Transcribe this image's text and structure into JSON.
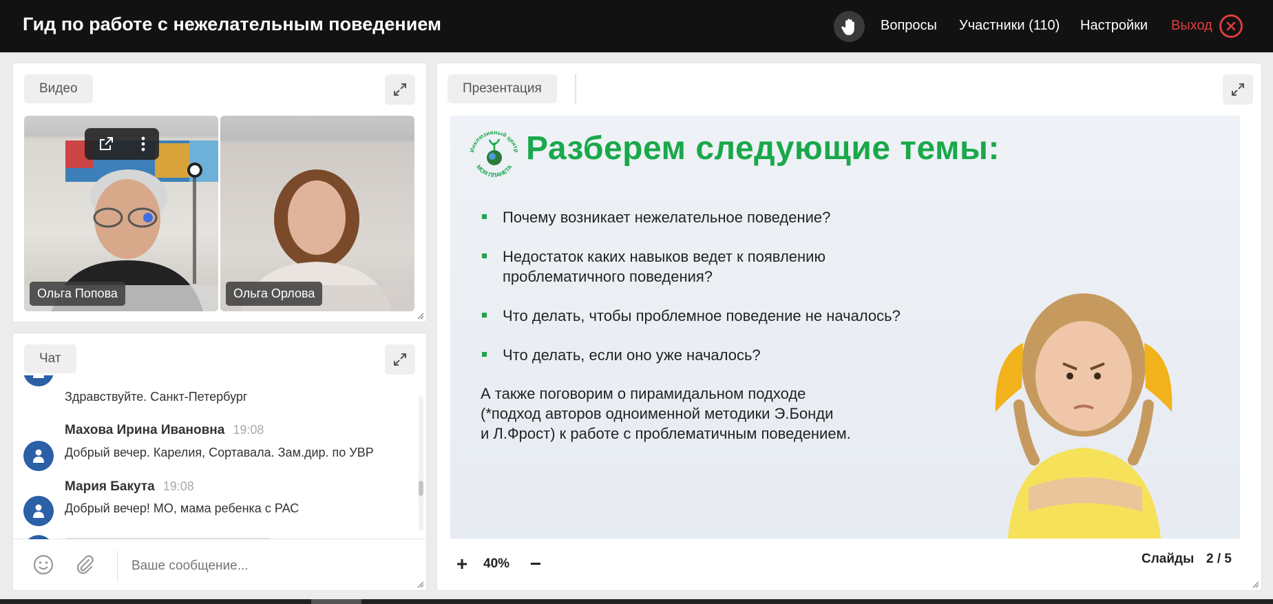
{
  "header": {
    "title": "Гид по работе с нежелательным поведением",
    "nav": {
      "questions": "Вопросы",
      "participants": "Участники (110)",
      "settings": "Настройки",
      "exit": "Выход"
    }
  },
  "video_panel": {
    "label": "Видео",
    "participants": [
      {
        "name": "Ольга Попова"
      },
      {
        "name": "Ольга Орлова"
      }
    ]
  },
  "chat_panel": {
    "label": "Чат",
    "messages": [
      {
        "name": "",
        "time": "",
        "text": "Здравствуйте. Санкт-Петербург"
      },
      {
        "name": "Махова Ирина Ивановна",
        "time": "19:08",
        "text": "Добрый вечер. Карелия, Сортавала. Зам.дир. по УВР"
      },
      {
        "name": "Мария Бакута",
        "time": "19:08",
        "text": "Добрый вечер! МО, мама ребенка с РАС"
      }
    ],
    "input_placeholder": "Ваше сообщение..."
  },
  "presentation_panel": {
    "label": "Презентация",
    "slide": {
      "logo_text_top": "Инклюзивный центр",
      "logo_text_bottom": "МОЯ ПЛАНЕТА",
      "title": "Разберем следующие темы:",
      "bullets": [
        "Почему возникает нежелательное поведение?",
        "Недостаток каких навыков ведет к появлению",
        "проблематичного поведения?",
        "Что делать, чтобы проблемное поведение не началось?",
        "Что делать, если оно уже началось?"
      ],
      "extra": [
        "А также поговорим о пирамидальном подходе",
        "(*подход авторов одноименной методики Э.Бонди",
        "и Л.Фрост) к работе с проблематичным поведением."
      ]
    },
    "zoom": "40%",
    "slides_label": "Слайды",
    "slides_counter": "2 / 5"
  },
  "colors": {
    "topbar": "#121212",
    "exit": "#e03c3c",
    "slide_title": "#19a84a",
    "avatar": "#2b5fa6"
  }
}
